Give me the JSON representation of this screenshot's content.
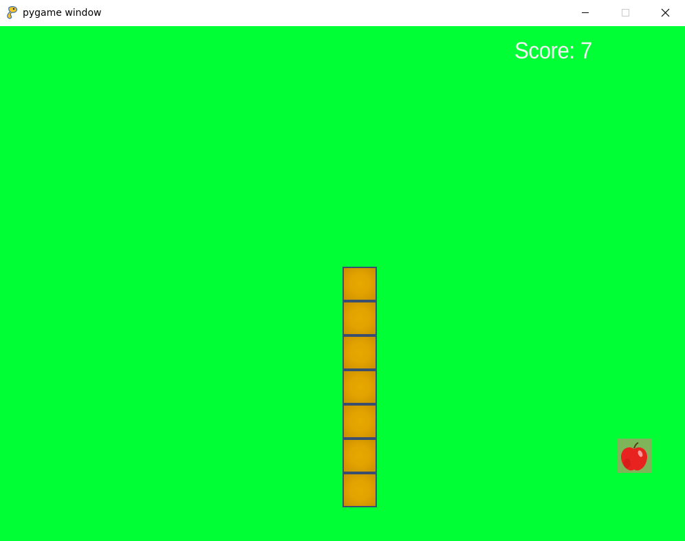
{
  "window": {
    "title": "pygame window",
    "icon": "pygame-snake-icon",
    "controls": {
      "minimize": "minimize-icon",
      "maximize": "maximize-icon",
      "close": "close-icon"
    }
  },
  "game": {
    "score_text": "Score: 7",
    "snake_length": 7,
    "food": "apple-icon",
    "colors": {
      "background": "#00ff35",
      "snake_body": "#e2a200",
      "snake_border": "#3a4f70",
      "apple": "#e8231f",
      "score_text": "#f2f2f2"
    }
  }
}
